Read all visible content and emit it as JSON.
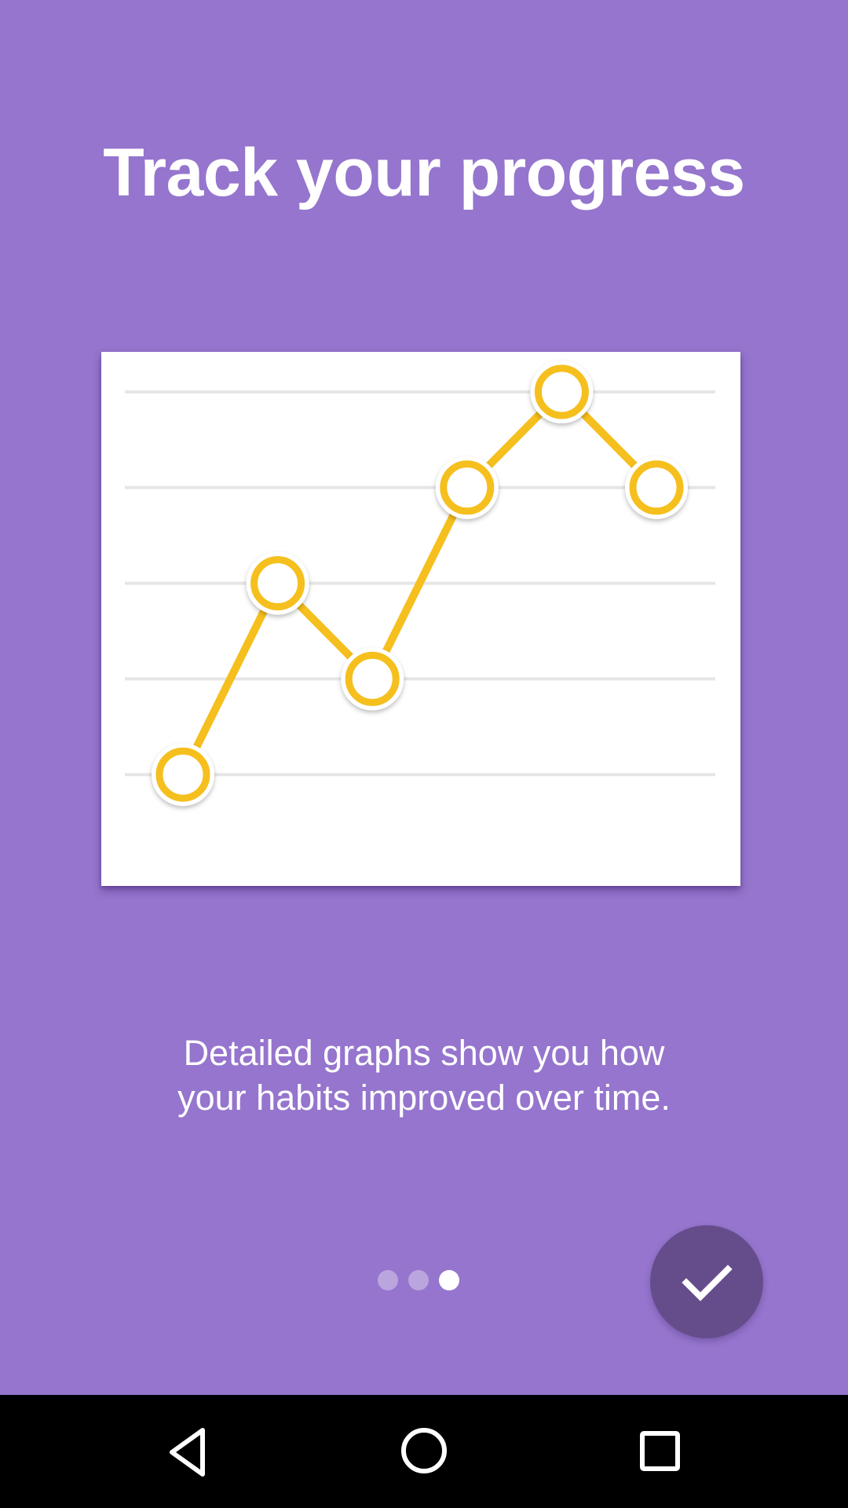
{
  "onboarding": {
    "title": "Track your progress",
    "description_lines": [
      "Detailed graphs show you how",
      "your habits improved over time."
    ],
    "page_indicator": {
      "total": 3,
      "current": 3
    },
    "done_button": {
      "icon": "check-icon"
    }
  },
  "illustration": {
    "icon": "line-chart-illustration",
    "line_color": "#f5bf1d",
    "grid_color": "#e6e6e6"
  },
  "chart_data": {
    "type": "line",
    "x": [
      1,
      2,
      3,
      4,
      5,
      6
    ],
    "values": [
      1,
      3,
      2,
      4,
      5,
      4
    ],
    "ylim": [
      0,
      5.75
    ],
    "grid": true
  },
  "colors": {
    "background": "#9575cd",
    "accent": "#f5bf1d",
    "fab": "#654d8c",
    "nav_bar": "#000000"
  },
  "nav_bar": {
    "back_icon": "back-triangle-icon",
    "home_icon": "home-circle-icon",
    "recents_icon": "recents-square-icon"
  }
}
